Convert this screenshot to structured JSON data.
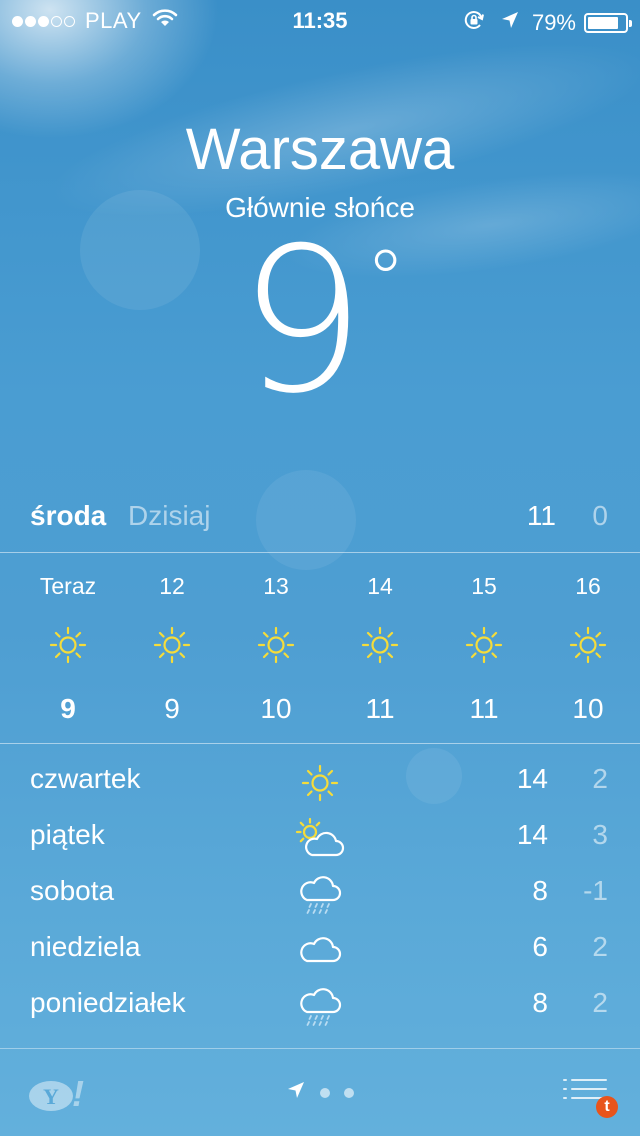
{
  "status_bar": {
    "signal_dots_filled": 3,
    "signal_dots_total": 5,
    "carrier": "PLAY",
    "time": "11:35",
    "battery": "79%"
  },
  "location": {
    "city": "Warszawa",
    "condition": "Głównie słońce",
    "temperature": "9",
    "degree_symbol": "°"
  },
  "today": {
    "day": "środa",
    "label": "Dzisiaj",
    "high": "11",
    "low": "0"
  },
  "hourly": [
    {
      "label": "Teraz",
      "icon": "sun-icon",
      "temp": "9"
    },
    {
      "label": "12",
      "icon": "sun-icon",
      "temp": "9"
    },
    {
      "label": "13",
      "icon": "sun-icon",
      "temp": "10"
    },
    {
      "label": "14",
      "icon": "sun-icon",
      "temp": "11"
    },
    {
      "label": "15",
      "icon": "sun-icon",
      "temp": "11"
    },
    {
      "label": "16",
      "icon": "sun-icon",
      "temp": "10"
    }
  ],
  "daily": [
    {
      "day": "czwartek",
      "icon": "sun-icon",
      "high": "14",
      "low": "2"
    },
    {
      "day": "piątek",
      "icon": "partly-cloudy-icon",
      "high": "14",
      "low": "3"
    },
    {
      "day": "sobota",
      "icon": "rain-cloud-icon",
      "high": "8",
      "low": "-1"
    },
    {
      "day": "niedziela",
      "icon": "cloud-icon",
      "high": "6",
      "low": "2"
    },
    {
      "day": "poniedziałek",
      "icon": "rain-cloud-icon",
      "high": "8",
      "low": "2"
    }
  ],
  "toolbar": {
    "logo": "Y!",
    "notification_badge": "t"
  },
  "colors": {
    "sun": "#f5dc3a",
    "sky_top": "#3a8fc8",
    "sky_bottom": "#63b0dc"
  }
}
